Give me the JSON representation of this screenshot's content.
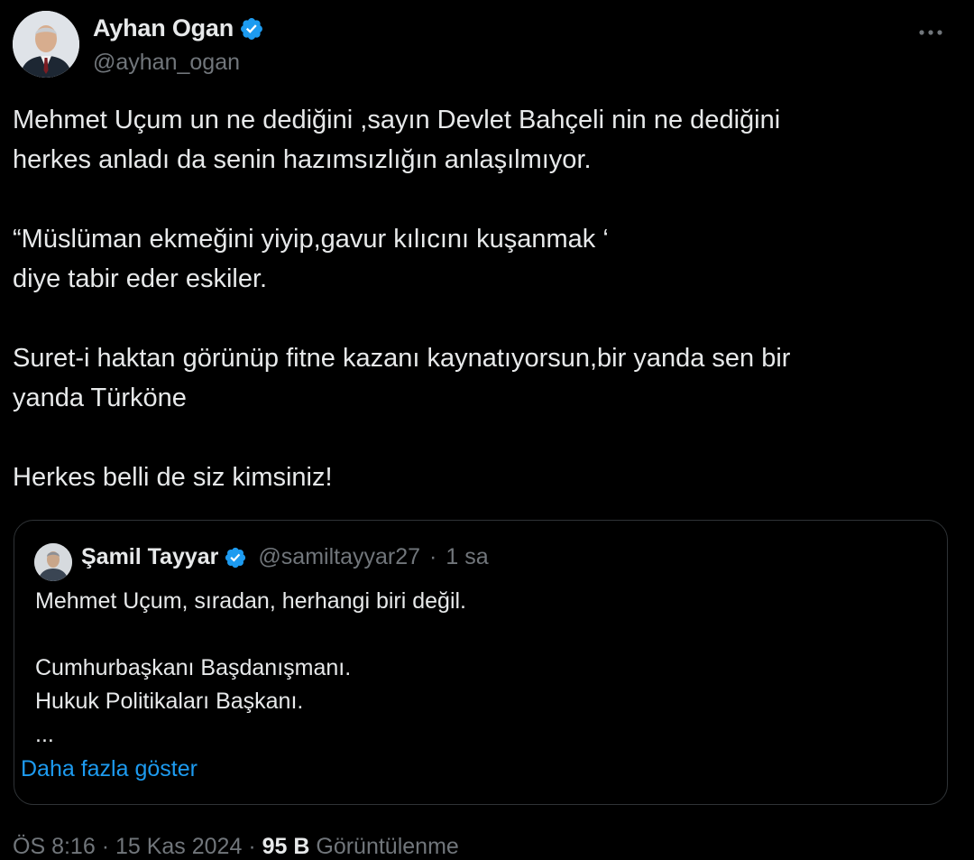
{
  "author": {
    "display_name": "Ayhan Ogan",
    "handle": "@ayhan_ogan",
    "verified_icon": "verified-badge-icon",
    "more_icon": "more-dots-icon"
  },
  "tweet": {
    "paragraphs": [
      [
        "Mehmet Uçum un ne dediğini ,sayın Devlet Bahçeli nin ne dediğini",
        "herkes anladı da senin hazımsızlığın anlaşılmıyor."
      ],
      [
        "“Müslüman ekmeğini yiyip,gavur kılıcını kuşanmak ‘",
        "diye tabir eder eskiler."
      ],
      [
        "Suret-i haktan görünüp fitne kazanı kaynatıyorsun,bir yanda sen bir",
        "yanda Türköne"
      ],
      [
        "Herkes belli de siz kimsiniz!"
      ]
    ]
  },
  "quote": {
    "display_name": "Şamil Tayyar",
    "handle": "@samiltayyar27",
    "separator": "·",
    "time": "1 sa",
    "paragraphs": [
      [
        "Mehmet Uçum, sıradan, herhangi biri değil."
      ],
      [
        "Cumhurbaşkanı Başdanışmanı.",
        "Hukuk Politikaları Başkanı.",
        "..."
      ]
    ],
    "show_more": "Daha fazla göster"
  },
  "footer": {
    "time": "ÖS 8:16",
    "date": "15 Kas 2024",
    "views": "95 B",
    "views_label": "Görüntülenme"
  },
  "colors": {
    "background": "#000000",
    "text": "#e7e9ea",
    "secondary": "#71767b",
    "accent": "#1d9bf0",
    "border": "#2f3336"
  }
}
